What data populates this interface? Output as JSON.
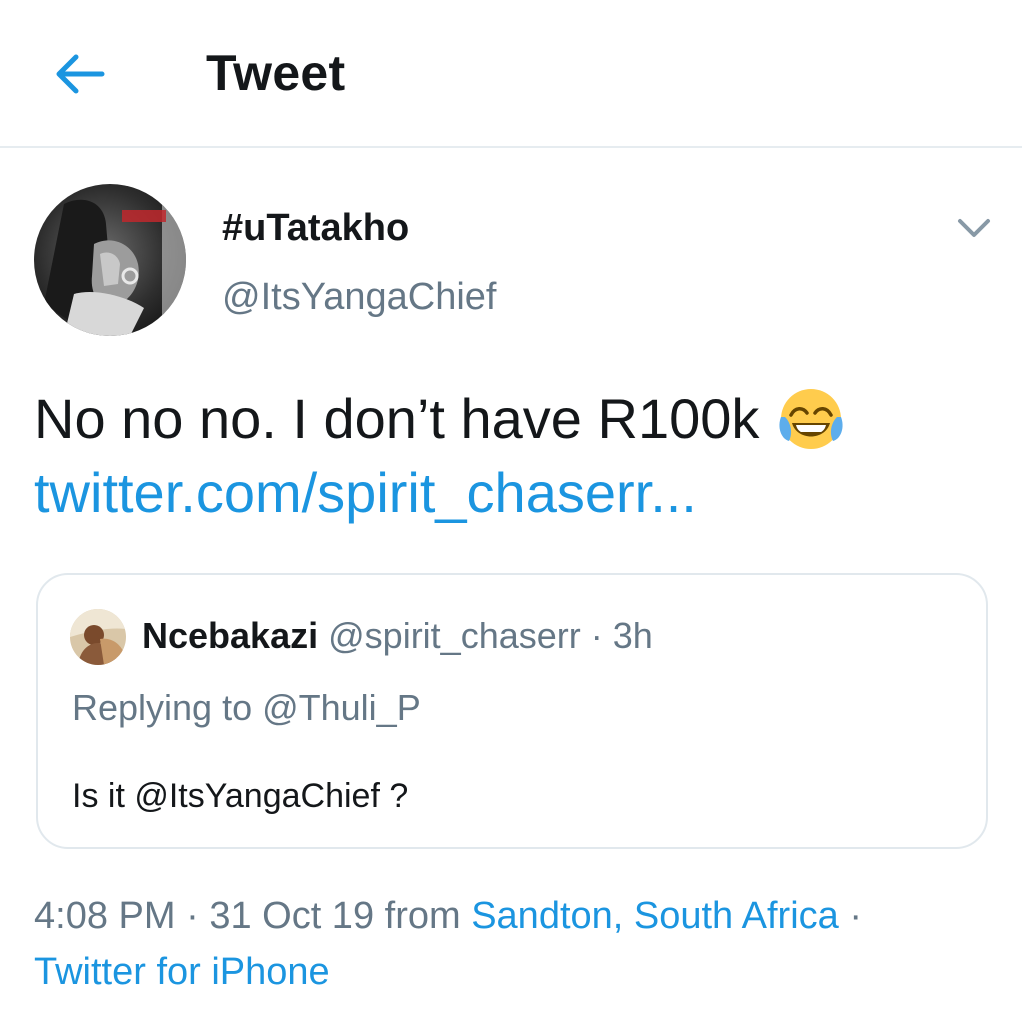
{
  "header": {
    "title": "Tweet",
    "back_icon": "arrow-left-icon",
    "accent_color": "#1b95e0"
  },
  "author": {
    "display_name": "#uTatakho",
    "handle": "@ItsYangaChief",
    "menu_icon": "chevron-down-icon"
  },
  "tweet": {
    "text": "No no no. I don’t have R100k",
    "emoji": "face-with-tears-of-joy-icon",
    "link": "twitter.com/spirit_chaserr..."
  },
  "quote": {
    "display_name": "Ncebakazi",
    "handle": "@spirit_chaserr",
    "separator": " · ",
    "time": "3h",
    "replying_to": "Replying to @Thuli_P",
    "text": "Is it @ItsYangaChief ?"
  },
  "meta": {
    "time": "4:08 PM",
    "separator": " · ",
    "date": "31 Oct 19",
    "from_label": " from ",
    "location": "Sandton, South Africa",
    "separator2": " ·",
    "client": "Twitter for iPhone"
  },
  "colors": {
    "text_primary": "#14171a",
    "text_secondary": "#657786",
    "link": "#1b95e0",
    "border": "#e1e8ed"
  }
}
